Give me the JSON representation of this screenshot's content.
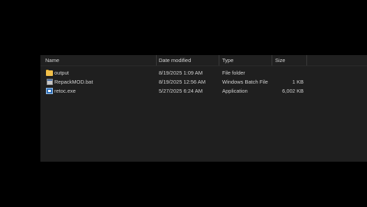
{
  "columns": {
    "name": "Name",
    "date_modified": "Date modified",
    "type": "Type",
    "size": "Size"
  },
  "files": [
    {
      "name": "output",
      "date": "8/19/2025 1:09 AM",
      "type": "File folder",
      "size": "",
      "icon": "folder-icon"
    },
    {
      "name": "RepackMOD.bat",
      "date": "8/19/2025 12:56 AM",
      "type": "Windows Batch File",
      "size": "1 KB",
      "icon": "batch-file-icon"
    },
    {
      "name": "retoc.exe",
      "date": "5/27/2025 6:24 AM",
      "type": "Application",
      "size": "6,002 KB",
      "icon": "application-icon"
    }
  ],
  "colors": {
    "background": "#000000",
    "pane": "#1f1f1f",
    "text": "#d2d2d2"
  }
}
